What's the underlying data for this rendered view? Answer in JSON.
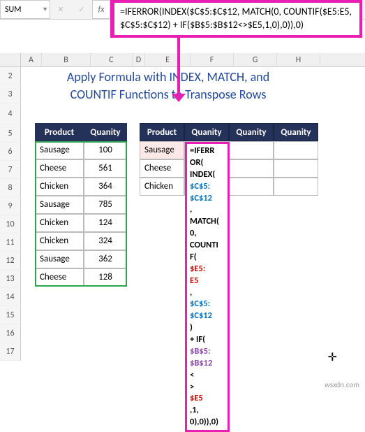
{
  "namebox": "SUM",
  "fx_label": "fx",
  "formula_bar": "=IFERROR(INDEX($C$5:$C$12, MATCH(0, COUNTIF($E5:E5, $C$5:$C$12) + IF($B$5:$B$12<>$E5,1,0),0)),0)",
  "title": {
    "line1": "Apply Formula with INDEX, MATCH, and",
    "line2": "COUNTIF Functions to Transpose Rows"
  },
  "columns": [
    "A",
    "B",
    "C",
    "D",
    "E",
    "F",
    "G",
    "H"
  ],
  "rows": [
    "2",
    "3",
    "4",
    "5",
    "6",
    "7",
    "8",
    "9",
    "10",
    "11",
    "12",
    "13",
    "14",
    "15",
    "16",
    "17"
  ],
  "table1": {
    "headers": [
      "Product",
      "Quanity"
    ],
    "data": [
      [
        "Sausage",
        "100"
      ],
      [
        "Cheese",
        "561"
      ],
      [
        "Chicken",
        "364"
      ],
      [
        "Sausage",
        "785"
      ],
      [
        "Chicken",
        "124"
      ],
      [
        "Chicken",
        "324"
      ],
      [
        "Sausage",
        "362"
      ],
      [
        "Cheese",
        "128"
      ]
    ]
  },
  "table2": {
    "headers": [
      "Product",
      "Quanity",
      "Quanity",
      "Quanity"
    ],
    "col1": [
      "Sausage",
      "Cheese",
      "Chicken"
    ]
  },
  "editing_formula_parts": [
    {
      "cls": "t-black",
      "t": "=IFERR"
    },
    {
      "cls": "t-black",
      "t": "OR("
    },
    {
      "cls": "t-black",
      "t": "INDEX("
    },
    {
      "cls": "t-blue",
      "t": "$C$5:"
    },
    {
      "cls": "t-blue",
      "t": "$C$12"
    },
    {
      "cls": "t-black",
      "t": ","
    },
    {
      "cls": "t-black",
      "t": "MATCH("
    },
    {
      "cls": "t-black",
      "t": "0,"
    },
    {
      "cls": "t-black",
      "t": "COUNTI"
    },
    {
      "cls": "t-black",
      "t": "F("
    },
    {
      "cls": "t-red",
      "t": "$E5:"
    },
    {
      "cls": "t-red",
      "t": "E5"
    },
    {
      "cls": "t-black",
      "t": ","
    },
    {
      "cls": "t-blue",
      "t": "$C$5:"
    },
    {
      "cls": "t-blue",
      "t": "$C$12"
    },
    {
      "cls": "t-black",
      "t": ")"
    },
    {
      "cls": "t-black",
      "t": "+ IF("
    },
    {
      "cls": "t-purple",
      "t": "$B$5:"
    },
    {
      "cls": "t-purple",
      "t": "$B$12"
    },
    {
      "cls": "t-black",
      "t": "<"
    },
    {
      "cls": "t-black",
      "t": ">"
    },
    {
      "cls": "t-red",
      "t": "$E5"
    },
    {
      "cls": "t-black",
      "t": ",1,"
    },
    {
      "cls": "t-black",
      "t": "0),0)),0)"
    }
  ],
  "watermark": "wsxdn.com",
  "cross": "✛"
}
